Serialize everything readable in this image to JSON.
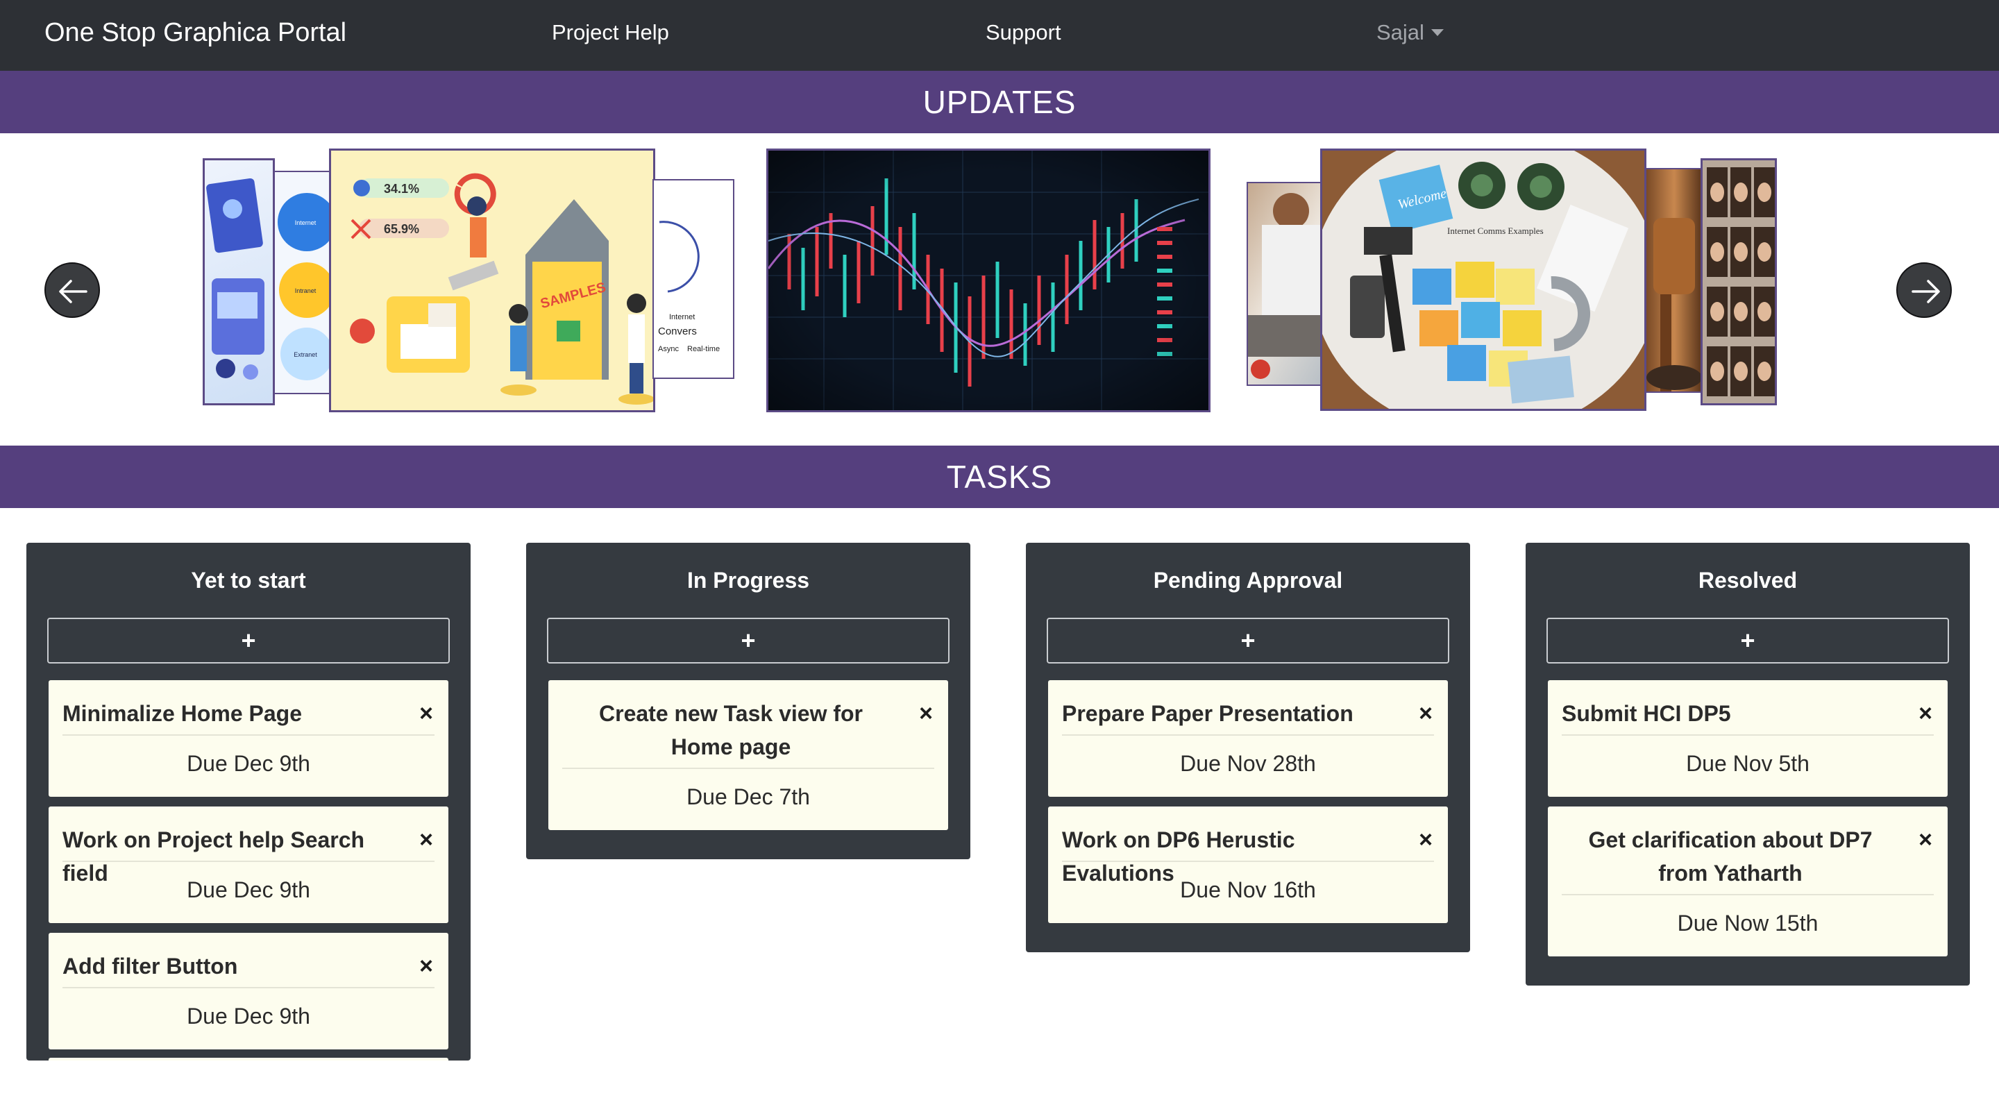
{
  "nav": {
    "brand": "One Stop Graphica Portal",
    "links": [
      "Project Help",
      "Support"
    ],
    "user": "Sajal"
  },
  "sections": {
    "updates": "UPDATES",
    "tasks": "TASKS"
  },
  "carousel": {
    "slides": [
      {
        "slide_text": [
          "Internet",
          "Intranet",
          "Extranet"
        ]
      },
      {
        "slide_text": [
          "34.1%",
          "65.9%",
          "SAMPLES"
        ]
      },
      {
        "slide_text": [
          "Internet",
          "Convers",
          "Async",
          "Real-time"
        ]
      },
      {
        "slide_text": []
      },
      {
        "slide_text": [
          "Welcome",
          "Internet Comms Examples"
        ]
      }
    ],
    "icons": {
      "prev": "arrow-left-icon",
      "next": "arrow-right-icon"
    }
  },
  "board": {
    "add_label": "+",
    "close_glyph": "×",
    "columns": [
      {
        "title": "Yet to start",
        "cards": [
          {
            "title": "Minimalize Home Page",
            "due": "Due Dec 9th"
          },
          {
            "title": "Work on Project help Search field",
            "due": "Due Dec 9th"
          },
          {
            "title": "Add filter Button",
            "due": "Due Dec 9th"
          }
        ]
      },
      {
        "title": "In Progress",
        "cards": [
          {
            "title": "Create new Task view for Home page",
            "due": "Due Dec 7th"
          }
        ]
      },
      {
        "title": "Pending Approval",
        "cards": [
          {
            "title": "Prepare Paper Presentation",
            "due": "Due Nov 28th"
          },
          {
            "title": "Work on DP6 Herustic Evalutions",
            "due": "Due Nov 16th"
          }
        ]
      },
      {
        "title": "Resolved",
        "cards": [
          {
            "title": "Submit HCI DP5",
            "due": "Due Nov 5th"
          },
          {
            "title": "Get clarification about DP7 from Yatharth",
            "due": "Due Now 15th"
          }
        ]
      }
    ]
  },
  "colors": {
    "navbar": "#2d3035",
    "band": "#553f7e",
    "column": "#353a40",
    "card": "#fdfdee"
  }
}
